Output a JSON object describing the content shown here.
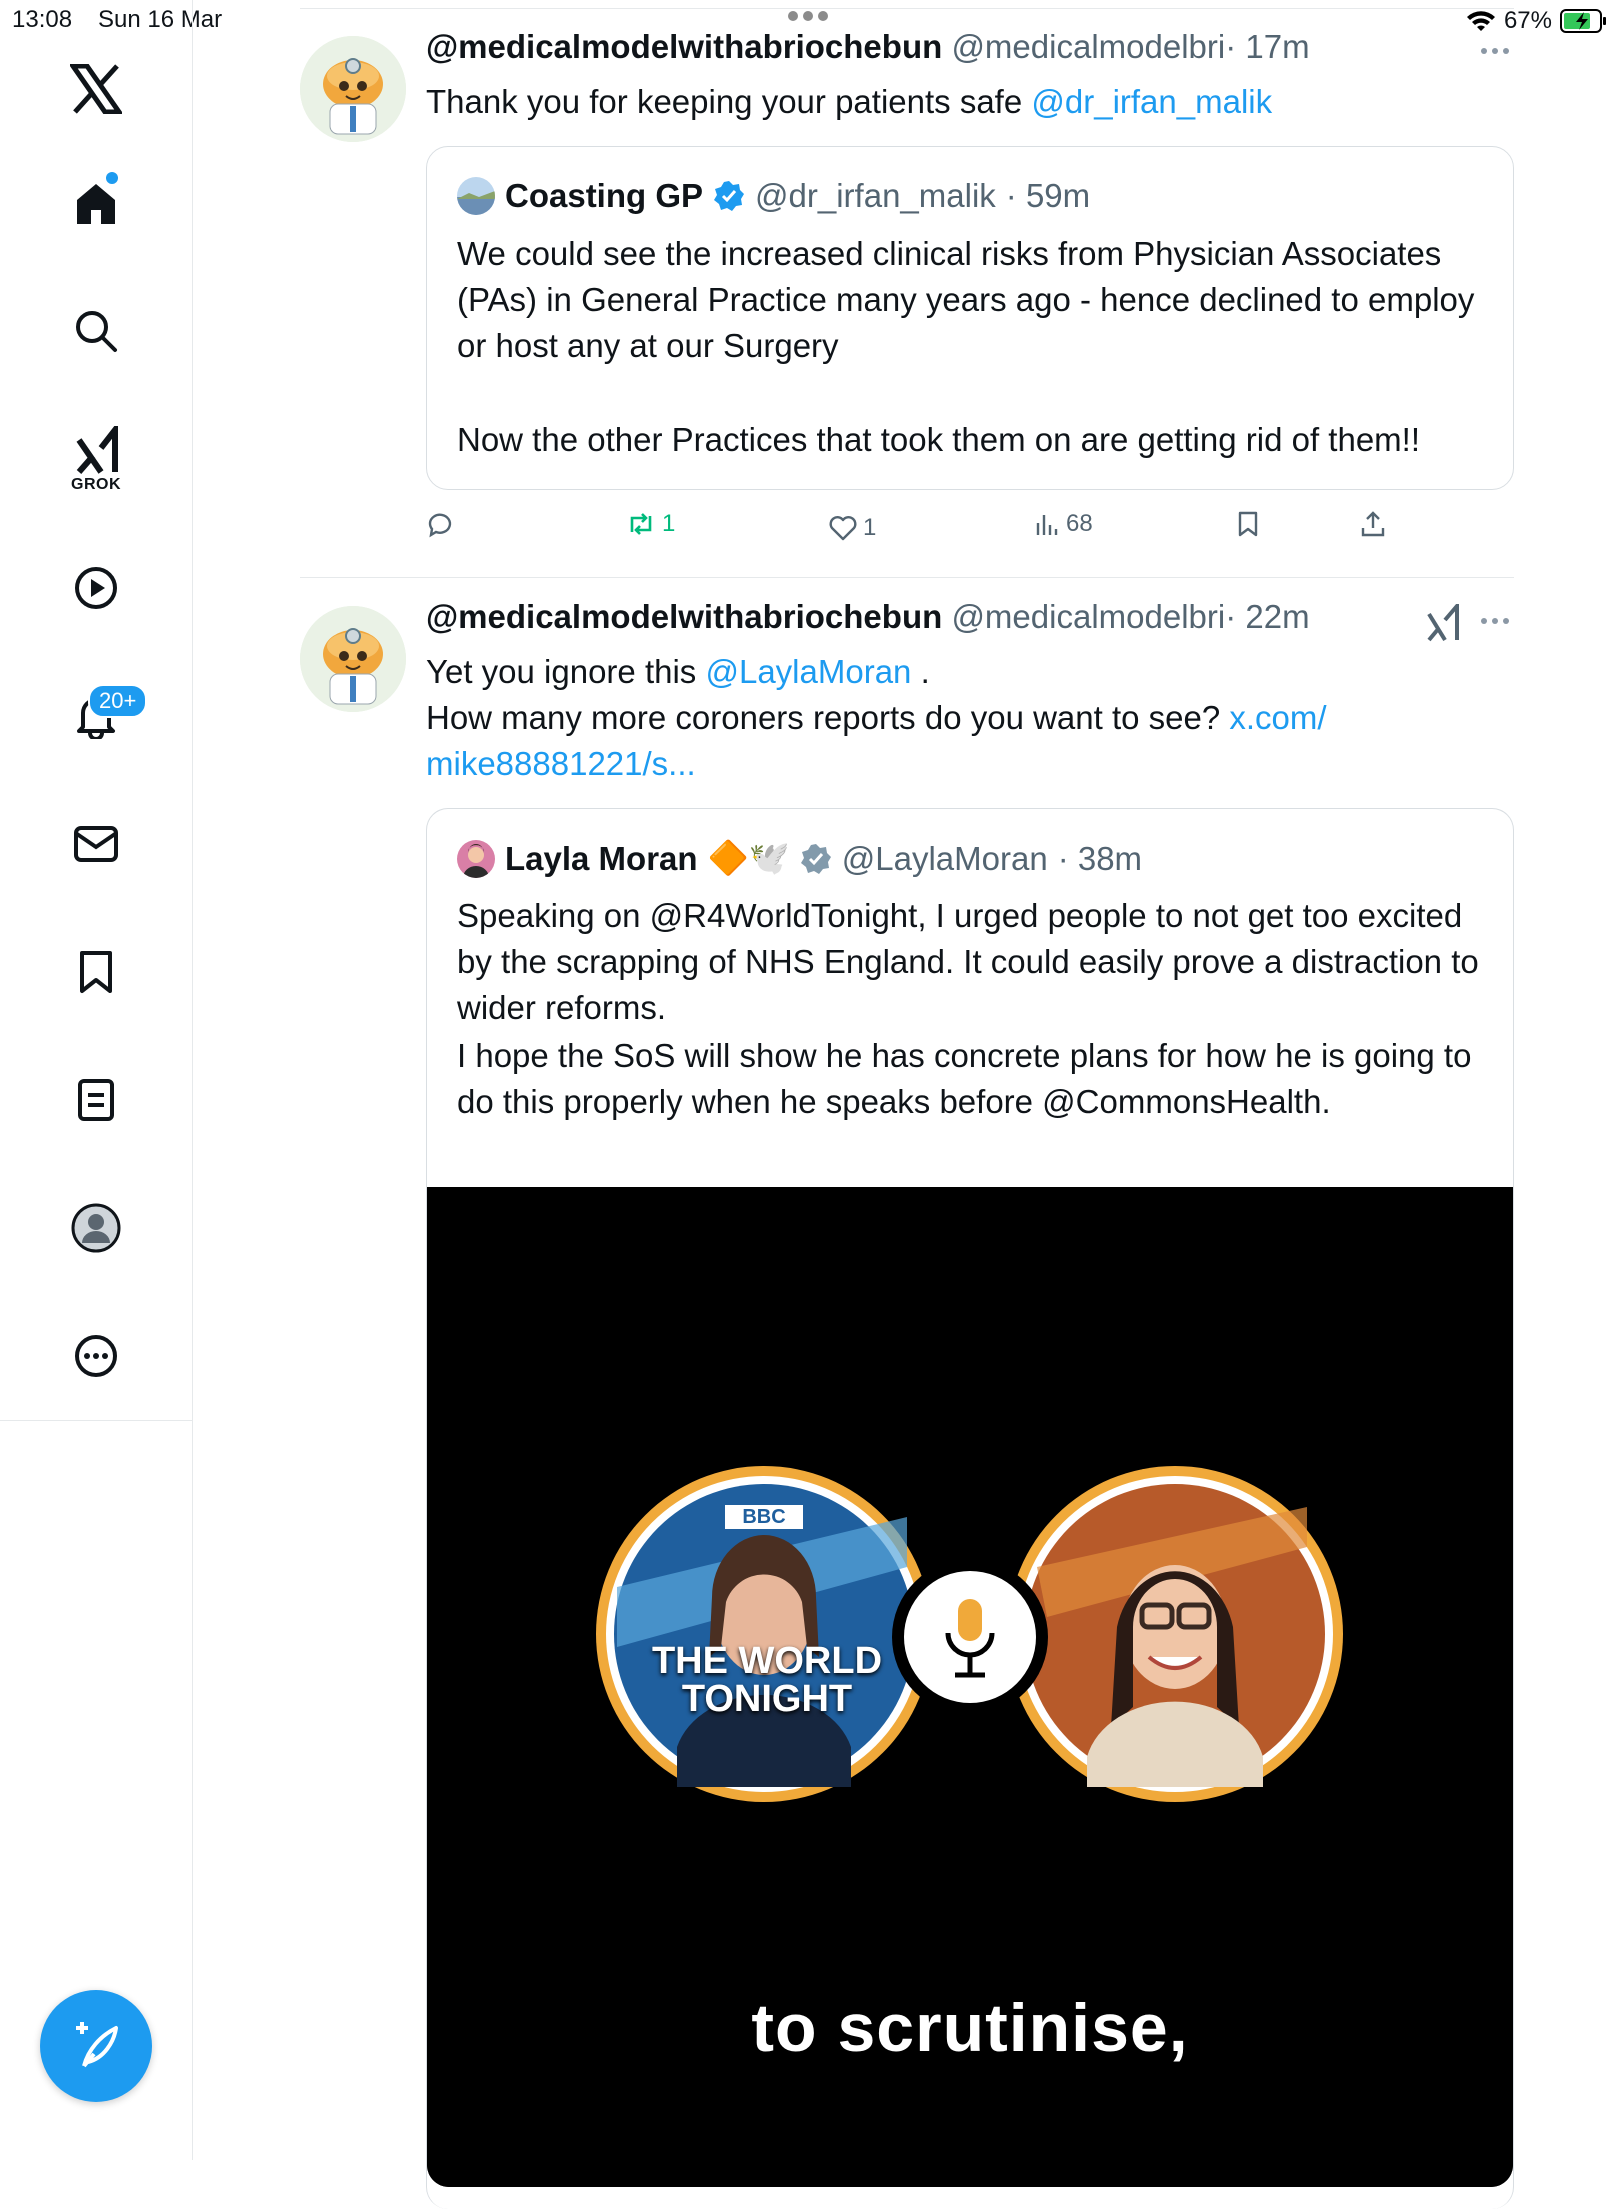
{
  "status_bar": {
    "time": "13:08",
    "date": "Sun 16 Mar",
    "battery": "67%"
  },
  "sidebar": {
    "grok_label": "GROK",
    "notifications_badge": "20+",
    "icons": [
      "x-logo-icon",
      "home-icon",
      "search-icon",
      "grok-icon",
      "video-icon",
      "bell-icon",
      "mail-icon",
      "bookmark-icon",
      "notes-icon",
      "profile-icon",
      "more-circle-icon"
    ],
    "compose_icon": "compose-feather-icon"
  },
  "colors": {
    "accent": "#1d9bf0",
    "text": "#0f1419",
    "muted": "#536471",
    "retweet": "#00ba7c",
    "border": "#e6e9eb"
  },
  "post1": {
    "name": "@medicalmodelwithabriochebun",
    "handle": "@medicalmodelbri",
    "time": "· 17m",
    "text": "Thank you for keeping your patients safe ",
    "mention": "@dr_irfan_malik",
    "quote": {
      "name": "Coasting GP",
      "handle": "@dr_irfan_malik",
      "time": "· 59m",
      "para1": "We could see the increased clinical risks from Physician Associates (PAs) in General Practice many years ago - hence declined to employ or host any at our Surgery",
      "para2": "Now the other Practices that took them on are getting rid of them!!"
    },
    "actions": {
      "replies": "",
      "reposts": "1",
      "likes": "1",
      "views": "68"
    }
  },
  "post2": {
    "name": "@medicalmodelwithabriochebun",
    "handle": "@medicalmodelbri",
    "time": "· 22m",
    "line1_pre": "Yet you ignore this ",
    "line1_mention": "@LaylaMoran",
    "line1_post": " .",
    "line2_pre": "How many more coroners reports do you want to see? ",
    "line2_link": "x.com/",
    "line3_link": "mike88881221/s...",
    "quote": {
      "name": "Layla Moran",
      "emoji": "🔶🕊️",
      "handle": "@LaylaMoran",
      "time": "· 38m",
      "para1": "Speaking on @R4WorldTonight, I urged people to not get too excited by the scrapping of NHS England. It could easily prove a distraction to wider reforms.",
      "para2": "I hope the SoS will show he has concrete plans for how he is going to do this properly when he speaks before @CommonsHealth.",
      "media": {
        "bbc_badge": "BBC",
        "show_line1": "THE WORLD",
        "show_line2": "TONIGHT",
        "caption": "to scrutinise,"
      }
    }
  }
}
